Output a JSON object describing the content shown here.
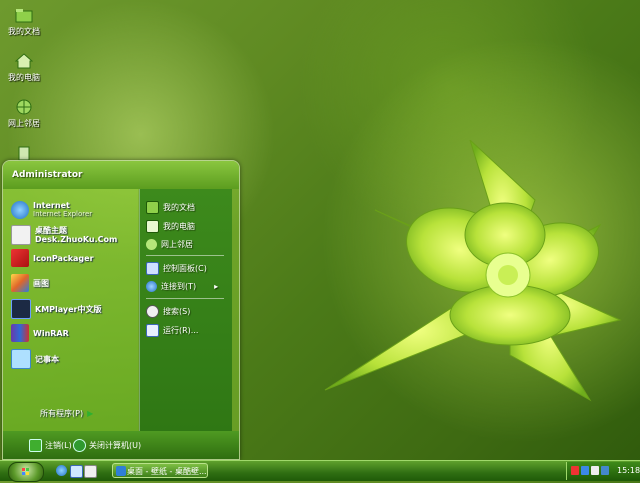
{
  "desktop": {
    "icons": [
      {
        "label": "我的文档",
        "icon": "folder-icon"
      },
      {
        "label": "我的电脑",
        "icon": "computer-icon"
      },
      {
        "label": "网上邻居",
        "icon": "network-icon"
      },
      {
        "label": "",
        "icon": "recycle-bin-icon"
      }
    ]
  },
  "start_menu": {
    "user": "Administrator",
    "pinned": [
      {
        "label": "Internet",
        "sub": "Internet Explorer",
        "icon": "ie-icon"
      },
      {
        "label": "桌酷主题Desk.ZhuoKu.Com",
        "icon": "zhuoku-icon"
      },
      {
        "label": "IconPackager",
        "icon": "iconpackager-icon"
      },
      {
        "label": "画图",
        "icon": "paint-icon"
      },
      {
        "label": "KMPlayer中文版",
        "icon": "kmplayer-icon"
      },
      {
        "label": "WinRAR",
        "icon": "winrar-icon"
      },
      {
        "label": "记事本",
        "icon": "notepad-icon"
      }
    ],
    "all_programs": "所有程序(P)",
    "right": [
      {
        "label": "我的文档",
        "icon": "folder-icon"
      },
      {
        "label": "我的电脑",
        "icon": "computer-icon"
      },
      {
        "label": "网上邻居",
        "icon": "network-icon"
      },
      {
        "label": "控制面板(C)",
        "icon": "control-panel-icon"
      },
      {
        "label": "连接到(T)",
        "icon": "connect-icon",
        "arrow": "▸"
      },
      {
        "label": "搜索(S)",
        "icon": "search-icon"
      },
      {
        "label": "运行(R)...",
        "icon": "run-icon"
      }
    ],
    "logoff": "注销(L)",
    "shutdown": "关闭计算机(U)"
  },
  "taskbar": {
    "task_label": "桌面 - 壁纸 - 桌酷壁...",
    "clock": "15:18"
  },
  "colors": {
    "accent": "#4f9a22",
    "taskbar": "#2f6e12"
  }
}
